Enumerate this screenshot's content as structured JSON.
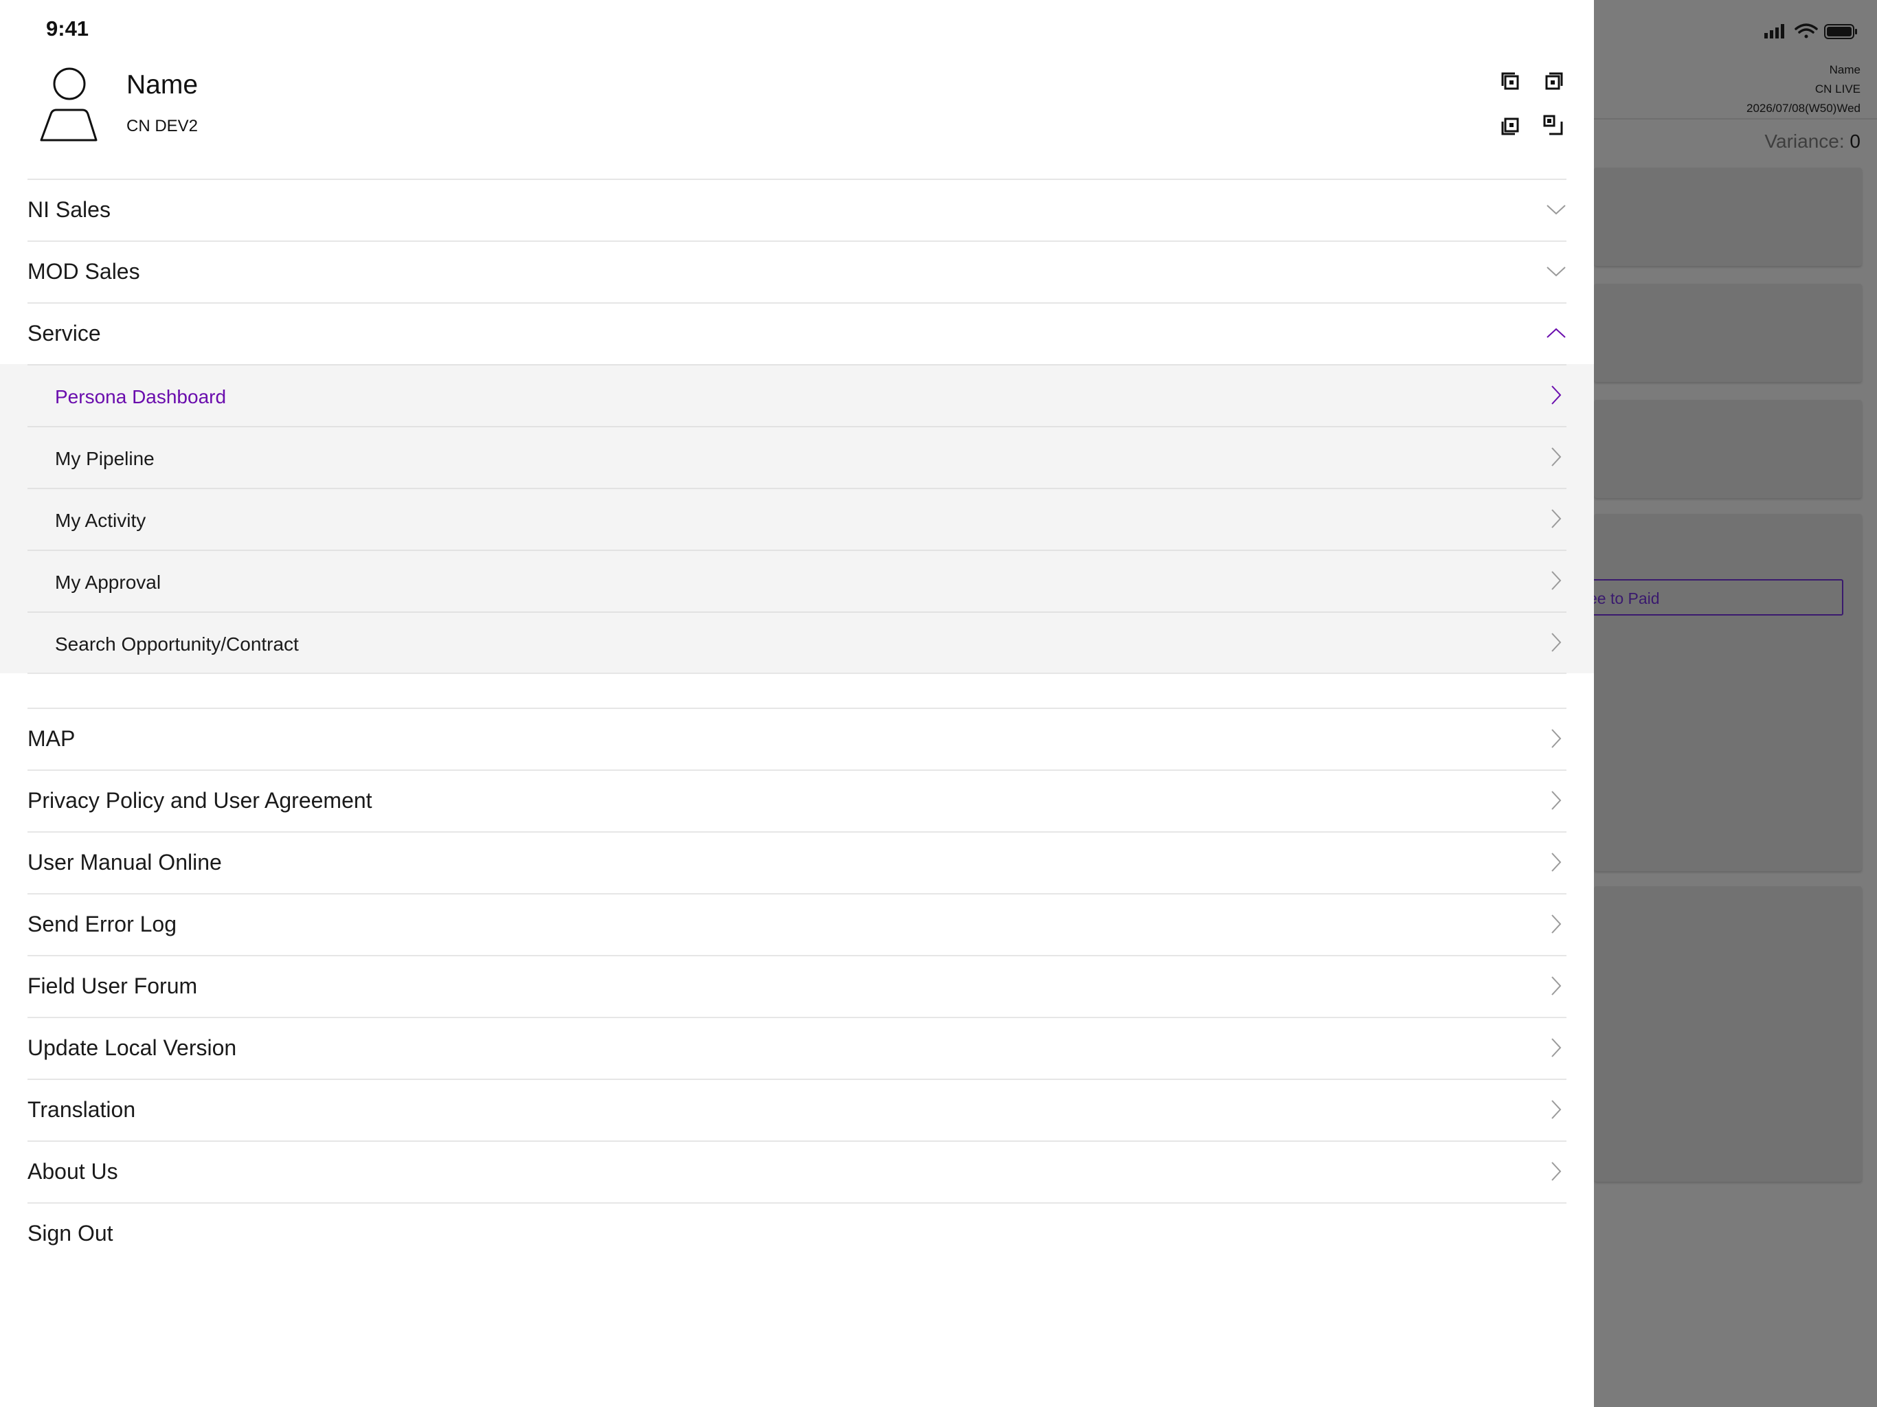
{
  "status_bar": {
    "time": "9:41"
  },
  "profile": {
    "name": "Name",
    "environment": "CN DEV2"
  },
  "icons": {
    "avatar": "person-icon",
    "qr": "qr-code-scan-icon",
    "chevron_down": "chevron-down-icon",
    "chevron_up": "chevron-up-icon",
    "chevron_right": "chevron-right-icon"
  },
  "colors": {
    "accent": "#6a0dad",
    "submenu_background": "#f4f4f4",
    "divider": "#e6e6e6",
    "overlay": "#7b7b7b"
  },
  "menu": {
    "sections": [
      {
        "label": "NI Sales",
        "state": "collapsed"
      },
      {
        "label": "MOD Sales",
        "state": "collapsed"
      },
      {
        "label": "Service",
        "state": "expanded"
      }
    ],
    "service_items": [
      {
        "label": "Persona Dashboard",
        "active": true
      },
      {
        "label": "My Pipeline"
      },
      {
        "label": "My Activity"
      },
      {
        "label": "My Approval"
      },
      {
        "label": "Search Opportunity/Contract"
      }
    ],
    "items": [
      {
        "label": "MAP"
      },
      {
        "label": "Privacy Policy and User Agreement"
      },
      {
        "label": "User Manual Online"
      },
      {
        "label": "Send Error Log"
      },
      {
        "label": "Field User Forum"
      },
      {
        "label": "Update Local Version"
      },
      {
        "label": "Translation"
      },
      {
        "label": "About Us"
      },
      {
        "label": "Sign Out"
      }
    ]
  },
  "background_app": {
    "header_name": "Name",
    "header_env": "CN LIVE",
    "header_date": "2026/07/08(W50)Wed",
    "variance_label": "Variance:",
    "variance_value": "0",
    "button_partial_label": "ee to Paid"
  }
}
